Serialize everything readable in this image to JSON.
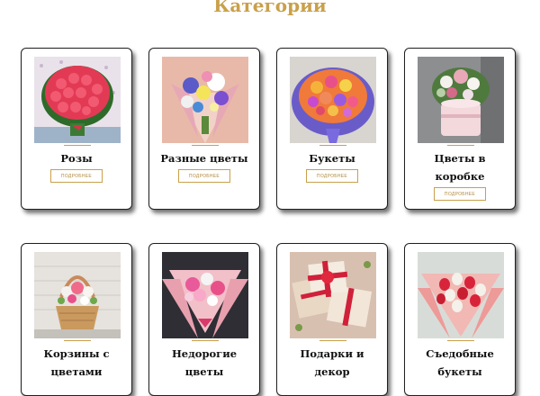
{
  "page": {
    "title": "Категории"
  },
  "colors": {
    "accent": "#c9a04b",
    "border": "#202020",
    "text": "#111111"
  },
  "categories": [
    {
      "title": "Розы",
      "button": "ПОДРОБНЕЕ",
      "image": "red-roses-bouquet"
    },
    {
      "title": "Разные цветы",
      "button": "ПОДРОБНЕЕ",
      "image": "mixed-flowers-bouquet"
    },
    {
      "title": "Букеты",
      "button": "ПОДРОБНЕЕ",
      "image": "colorful-bouquet"
    },
    {
      "title": "Цветы в коробке",
      "button": "ПОДРОБНЕЕ",
      "image": "flowers-in-box"
    },
    {
      "title": "Корзины с цветами",
      "button": "",
      "image": "flower-basket"
    },
    {
      "title": "Недорогие цветы",
      "button": "",
      "image": "pink-bouquet"
    },
    {
      "title": "Подарки и декор",
      "button": "",
      "image": "gift-boxes"
    },
    {
      "title": "Съедобные букеты",
      "button": "",
      "image": "strawberry-bouquet"
    }
  ]
}
